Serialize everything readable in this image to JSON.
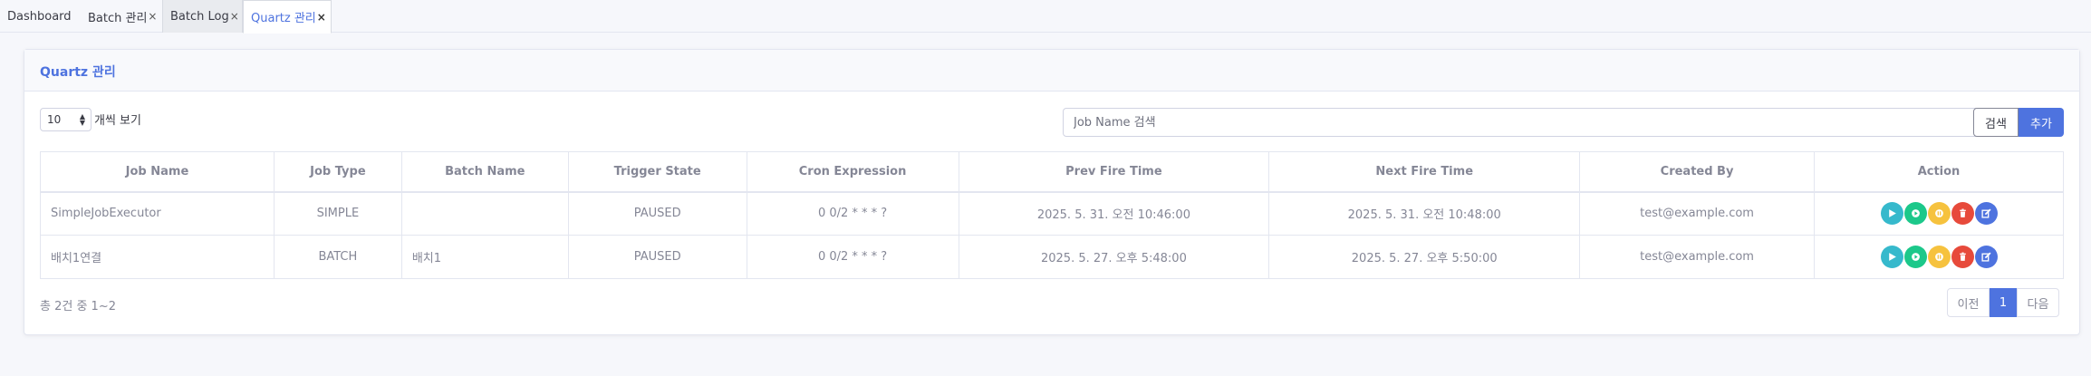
{
  "tabs": [
    {
      "label": "Dashboard",
      "closable": false
    },
    {
      "label": "Batch 관리",
      "closable": true,
      "close": "×"
    },
    {
      "label": "Batch Log",
      "closable": true,
      "close": "×"
    },
    {
      "label": "Quartz 관리",
      "closable": true,
      "close": "×",
      "active": true
    }
  ],
  "card": {
    "title": "Quartz 관리"
  },
  "controls": {
    "page_size": "10",
    "page_size_label": "개씩 보기",
    "search_placeholder": "Job Name 검색",
    "search_button": "검색",
    "add_button": "추가"
  },
  "table": {
    "headers": [
      "Job Name",
      "Job Type",
      "Batch Name",
      "Trigger State",
      "Cron Expression",
      "Prev Fire Time",
      "Next Fire Time",
      "Created By",
      "Action"
    ],
    "rows": [
      {
        "job_name": "SimpleJobExecutor",
        "job_type": "SIMPLE",
        "batch_name": "",
        "trigger_state": "PAUSED",
        "cron": "0 0/2 * * * ?",
        "prev_fire": "2025. 5. 31. 오전 10:46:00",
        "next_fire": "2025. 5. 31. 오전 10:48:00",
        "created_by": "test@example.com"
      },
      {
        "job_name": "배치1연결",
        "job_type": "BATCH",
        "batch_name": "배치1",
        "trigger_state": "PAUSED",
        "cron": "0 0/2 * * * ?",
        "prev_fire": "2025. 5. 27. 오후 5:48:00",
        "next_fire": "2025. 5. 27. 오후 5:50:00",
        "created_by": "test@example.com"
      }
    ],
    "action_icons": [
      {
        "name": "play-icon",
        "color": "#36b9cc"
      },
      {
        "name": "resume-icon",
        "color": "#1cc88a"
      },
      {
        "name": "pause-icon",
        "color": "#f6c23e"
      },
      {
        "name": "trash-icon",
        "color": "#e74a3b"
      },
      {
        "name": "edit-icon",
        "color": "#4e73df"
      }
    ]
  },
  "footer": {
    "summary": "총 2건 중 1~2",
    "prev": "이전",
    "current_page": "1",
    "next": "다음"
  },
  "colors": {
    "accent": "#4e73df",
    "text": "#858796",
    "border": "#e3e6f0"
  }
}
